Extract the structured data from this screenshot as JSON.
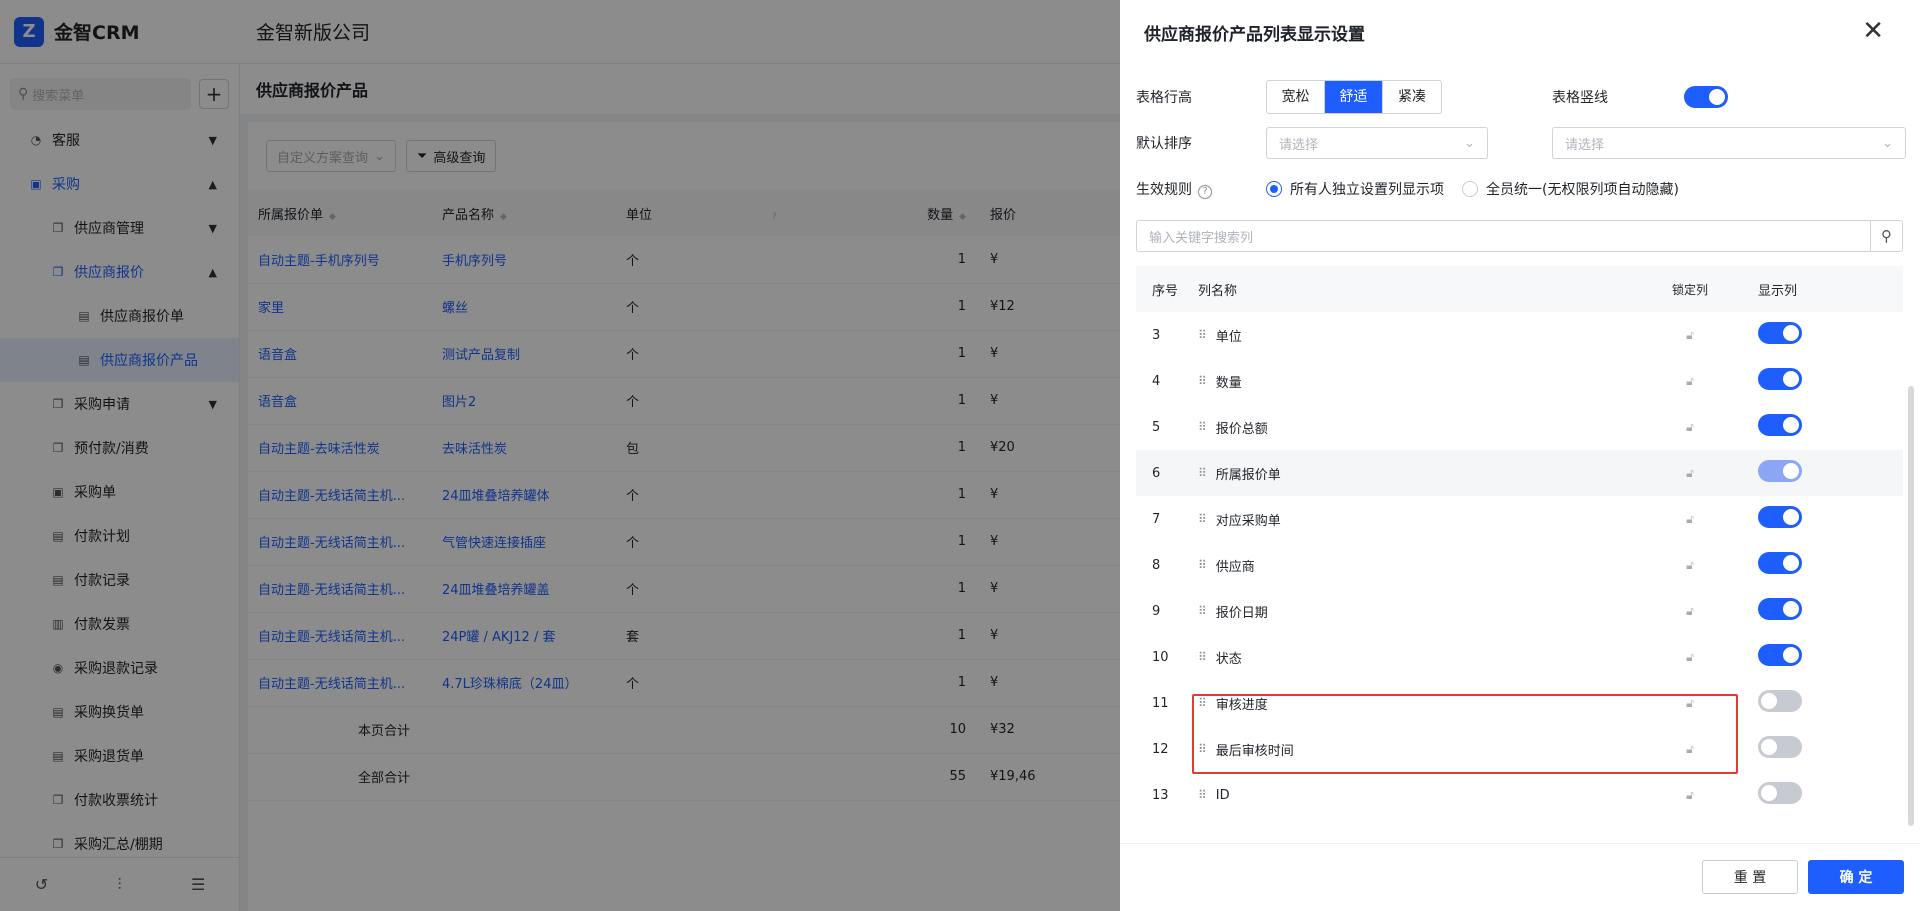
{
  "app": {
    "logo_glyph": "Z",
    "name": "金智CRM",
    "company": "金智新版公司"
  },
  "sidebar": {
    "search_placeholder": "搜索菜单",
    "add_label": "+",
    "items": [
      {
        "label": "客服",
        "icon": "headset-icon"
      },
      {
        "label": "采购",
        "icon": "bag-icon"
      },
      {
        "label": "供应商管理",
        "icon": "copy-icon"
      },
      {
        "label": "供应商报价",
        "icon": "copy-icon"
      },
      {
        "label": "供应商报价单",
        "icon": "doc-icon"
      },
      {
        "label": "供应商报价产品",
        "icon": "doc-icon"
      },
      {
        "label": "采购申请",
        "icon": "copy-icon"
      },
      {
        "label": "预付款/消费",
        "icon": "copy-icon"
      },
      {
        "label": "采购单",
        "icon": "bag-icon"
      },
      {
        "label": "付款计划",
        "icon": "doc-icon"
      },
      {
        "label": "付款记录",
        "icon": "doc-icon"
      },
      {
        "label": "付款发票",
        "icon": "invoice-icon"
      },
      {
        "label": "采购退款记录",
        "icon": "refund-icon"
      },
      {
        "label": "采购换货单",
        "icon": "doc-icon"
      },
      {
        "label": "采购退货单",
        "icon": "doc-icon"
      },
      {
        "label": "付款收票统计",
        "icon": "copy-icon"
      },
      {
        "label": "采购汇总/棚期",
        "icon": "copy-icon"
      }
    ]
  },
  "main": {
    "title": "供应商报价产品",
    "filter_placeholder": "自定义方案查询",
    "advanced_label": "高级查询",
    "columns": [
      "所属报价单",
      "产品名称",
      "单位",
      "数量",
      "报价"
    ],
    "rows": [
      [
        "自动主题-手机序列号",
        "手机序列号",
        "个",
        "1",
        "¥"
      ],
      [
        "家里",
        "螺丝",
        "个",
        "1",
        "¥12"
      ],
      [
        "语音盒",
        "测试产品复制",
        "个",
        "1",
        "¥"
      ],
      [
        "语音盒",
        "图片2",
        "个",
        "1",
        "¥"
      ],
      [
        "自动主题-去味活性炭",
        "去味活性炭",
        "包",
        "1",
        "¥20"
      ],
      [
        "自动主题-无线话简主机...",
        "24皿堆叠培养罐体",
        "个",
        "1",
        "¥"
      ],
      [
        "自动主题-无线话简主机...",
        "气管快速连接插座",
        "个",
        "1",
        "¥"
      ],
      [
        "自动主题-无线话简主机...",
        "24皿堆叠培养罐盖",
        "个",
        "1",
        "¥"
      ],
      [
        "自动主题-无线话简主机...",
        "24P罐 / AKJ12 / 套",
        "套",
        "1",
        "¥"
      ],
      [
        "自动主题-无线话简主机...",
        "4.7L珍珠棉底（24皿）",
        "个",
        "1",
        "¥"
      ]
    ],
    "page_total_label": "本页合计",
    "page_total_qty": "10",
    "page_total_price": "¥32",
    "all_total_label": "全部合计",
    "all_total_qty": "55",
    "all_total_price": "¥19,46"
  },
  "drawer": {
    "title": "供应商报价产品列表显示设置",
    "row_height_label": "表格行高",
    "row_height_options": [
      "宽松",
      "舒适",
      "紧凑"
    ],
    "row_height_selected": "舒适",
    "vertical_line_label": "表格竖线",
    "vertical_line_on": true,
    "default_sort_label": "默认排序",
    "sort_placeholder_1": "请选择",
    "sort_placeholder_2": "请选择",
    "rule_label": "生效规则",
    "rule_option_1": "所有人独立设置列显示项",
    "rule_option_2": "全员统一(无权限列项自动隐藏)",
    "column_search_placeholder": "输入关键字搜索列",
    "table_headers": {
      "no": "序号",
      "name": "列名称",
      "lock": "锁定列",
      "show": "显示列"
    },
    "columns": [
      {
        "no": "3",
        "name": "单位",
        "show": "on"
      },
      {
        "no": "4",
        "name": "数量",
        "show": "on"
      },
      {
        "no": "5",
        "name": "报价总额",
        "show": "on"
      },
      {
        "no": "6",
        "name": "所属报价单",
        "show": "light"
      },
      {
        "no": "7",
        "name": "对应采购单",
        "show": "on"
      },
      {
        "no": "8",
        "name": "供应商",
        "show": "on"
      },
      {
        "no": "9",
        "name": "报价日期",
        "show": "on"
      },
      {
        "no": "10",
        "name": "状态",
        "show": "on"
      },
      {
        "no": "11",
        "name": "审核进度",
        "show": "off"
      },
      {
        "no": "12",
        "name": "最后审核时间",
        "show": "off"
      },
      {
        "no": "13",
        "name": "ID",
        "show": "off"
      }
    ],
    "reset_label": "重 置",
    "ok_label": "确 定"
  },
  "colors": {
    "primary": "#1e5eff",
    "highlight": "#e53935"
  }
}
